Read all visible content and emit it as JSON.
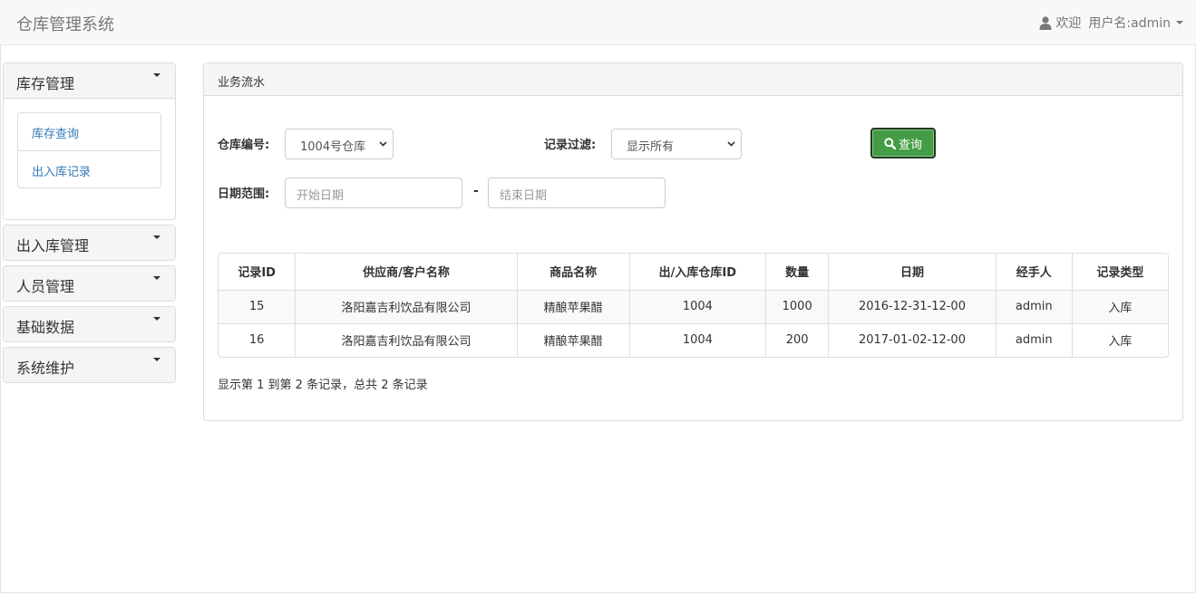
{
  "navbar": {
    "brand": "仓库管理系统",
    "welcome": "欢迎",
    "user_label": "用户名:admin"
  },
  "sidebar": {
    "sections": [
      {
        "label": "库存管理",
        "expanded": true,
        "items": [
          "库存查询",
          "出入库记录"
        ]
      },
      {
        "label": "出入库管理",
        "expanded": false
      },
      {
        "label": "人员管理",
        "expanded": false
      },
      {
        "label": "基础数据",
        "expanded": false
      },
      {
        "label": "系统维护",
        "expanded": false
      }
    ]
  },
  "panel": {
    "title": "业务流水",
    "warehouse_label": "仓库编号:",
    "warehouse_value": "1004号仓库",
    "filter_label": "记录过滤:",
    "filter_value": "显示所有",
    "query_label": "查询",
    "date_label": "日期范围:",
    "start_placeholder": "开始日期",
    "end_placeholder": "结束日期",
    "date_separator": "-"
  },
  "table": {
    "headers": [
      "记录ID",
      "供应商/客户名称",
      "商品名称",
      "出/入库仓库ID",
      "数量",
      "日期",
      "经手人",
      "记录类型"
    ],
    "rows": [
      [
        "15",
        "洛阳嘉吉利饮品有限公司",
        "精酿苹果醋",
        "1004",
        "1000",
        "2016-12-31-12-00",
        "admin",
        "入库"
      ],
      [
        "16",
        "洛阳嘉吉利饮品有限公司",
        "精酿苹果醋",
        "1004",
        "200",
        "2017-01-02-12-00",
        "admin",
        "入库"
      ]
    ],
    "summary": "显示第 1 到第 2 条记录，总共 2 条记录"
  },
  "icons": {
    "user": "user-icon",
    "search": "search-icon",
    "caret": "caret-down-icon"
  },
  "colors": {
    "query_button": "#449d44",
    "link": "#337ab7"
  }
}
